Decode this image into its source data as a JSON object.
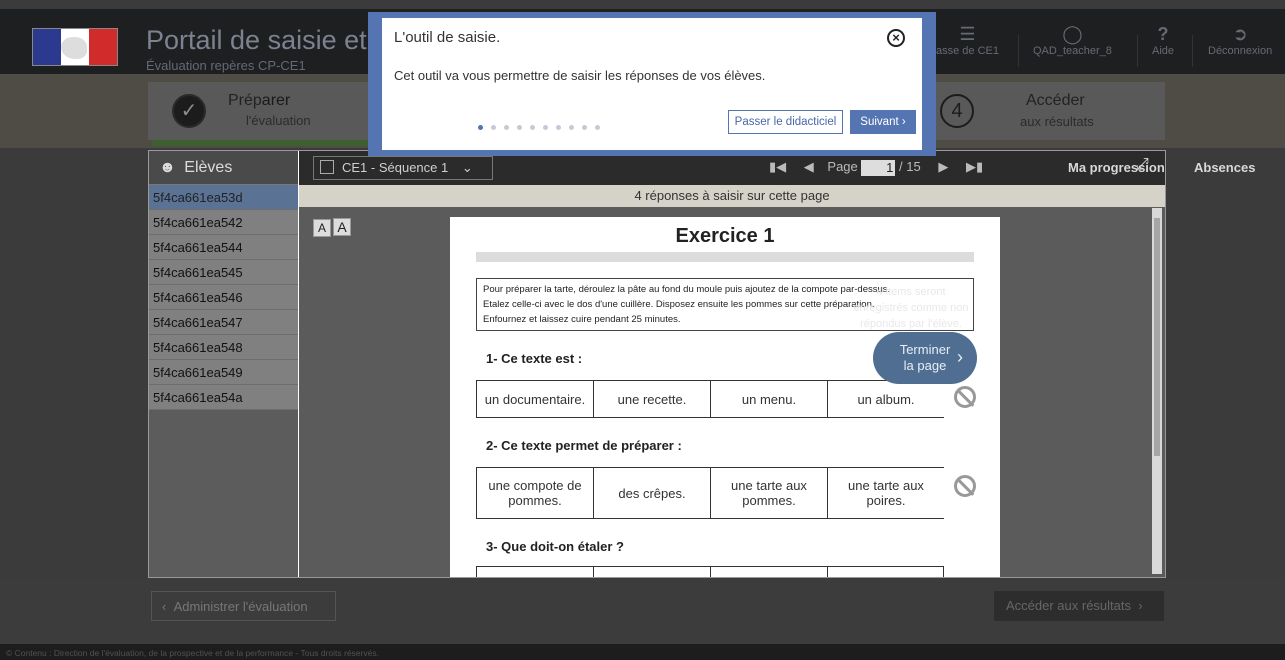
{
  "header": {
    "title": "Portail de saisie et d",
    "subtitle": "Évaluation repères CP-CE1",
    "class_label": "asse de CE1",
    "user_label": "QAD_teacher_8",
    "help_label": "Aide",
    "logout_label": "Déconnexion"
  },
  "stepper": {
    "step1_title": "Prép",
    "step1_title_b": "arer",
    "step1_sub": "l'évalu",
    "step1_sub_b": "ation",
    "step4_number": "4",
    "step4_title": "Accéder",
    "step4_sub": "aux résultats"
  },
  "sidebar": {
    "title": "Elèves",
    "students": [
      "5f4ca661ea53d",
      "5f4ca661ea542",
      "5f4ca661ea544",
      "5f4ca661ea545",
      "5f4ca661ea546",
      "5f4ca661ea547",
      "5f4ca661ea548",
      "5f4ca661ea549",
      "5f4ca661ea54a"
    ]
  },
  "toolbar": {
    "sequence": "CE1 - Séquence 1",
    "page_label": "Page",
    "page_current": "1",
    "page_total": "/ 15",
    "progress_label": "Ma progression",
    "absences_label": "Absences"
  },
  "info_bar": "4 réponses à saisir sur cette page",
  "zoom": {
    "small": "A",
    "large": "A"
  },
  "exercise": {
    "title": "Exercice 1",
    "text_line1": "Pour préparer la tarte, déroulez la pâte au fond du moule puis ajoutez de la compote par-dessus.",
    "text_line2": "Etalez celle-ci avec le dos d'une cuillère. Disposez ensuite les pommes sur cette préparation.",
    "text_line3": "Enfournez et laissez cuire pendant 25 minutes.",
    "q1": "1- Ce texte est :",
    "q1_options": [
      "un documentaire.",
      "une recette.",
      "un menu.",
      "un album."
    ],
    "q2": "2- Ce texte permet de préparer :",
    "q2_options": [
      "une compote de pommes.",
      "des crêpes.",
      "une tarte aux pommes.",
      "une tarte aux poires."
    ],
    "q3": "3- Que doit-on étaler ?"
  },
  "side_panel": {
    "info": "4 items seront enregistrés comme non répondus par l'élève.",
    "finish_line1": "Terminer",
    "finish_line2": "la page"
  },
  "bottom": {
    "back_label": "Administrer l'évaluation",
    "next_label": "Accéder aux résultats"
  },
  "footer": "© Contenu : Direction de l'évaluation, de la prospective et de la performance - Tous droits réservés.",
  "tour": {
    "title": "L'outil de saisie.",
    "body": "Cet outil va vous permettre de saisir les réponses de vos élèves.",
    "skip_label": "Passer le didacticiel",
    "next_label": "Suivant",
    "total_steps": 10,
    "current_step": 1
  }
}
